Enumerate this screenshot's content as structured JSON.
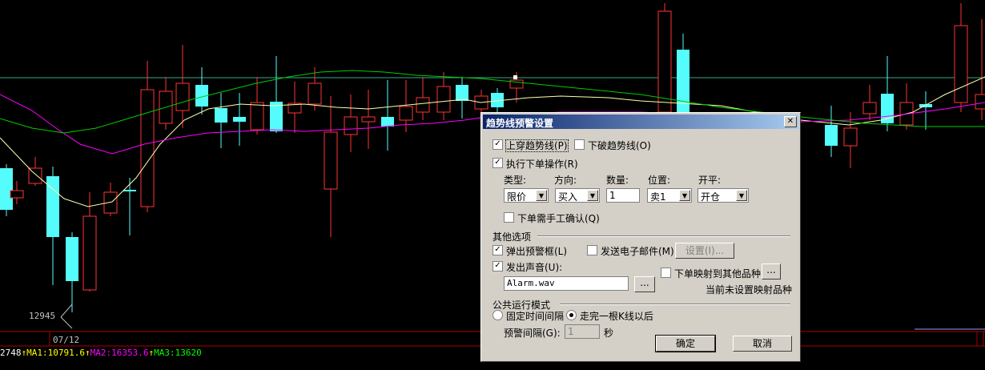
{
  "chart": {
    "low_price_label": "12945",
    "date_label": "07/12",
    "ma_bar": {
      "prefix": "2748",
      "ma1": "MA1:10791.6",
      "ma2": "MA2:16353.6",
      "ma3": "MA3:13620",
      "arrow": "↑",
      "colors": {
        "prefix": "#ffffff",
        "ma1": "#ffff00",
        "ma2": "#ff00ff",
        "ma3": "#00ff00",
        "arrow": "#ffff00"
      }
    },
    "colors": {
      "up": "#ff3333",
      "down": "#54fcfc",
      "ma1": "#ffffaa",
      "ma2": "#ff00ff",
      "ma3": "#00cc00",
      "ref": "#33aa88"
    }
  },
  "dialog": {
    "title": "趋势线预警设置",
    "close_glyph": "✕",
    "cross_up_label": "上穿趋势线(P)",
    "cross_up_checked": true,
    "break_down_label": "下破趋势线(O)",
    "break_down_checked": false,
    "exec_order_label": "执行下单操作(R)",
    "exec_order_checked": true,
    "order": {
      "type_label": "类型:",
      "type_value": "限价",
      "direction_label": "方向:",
      "direction_value": "买入",
      "qty_label": "数量:",
      "qty_value": "1",
      "position_label": "位置:",
      "position_value": "卖1",
      "open_close_label": "开平:",
      "open_close_value": "开仓"
    },
    "manual_confirm_label": "下单需手工确认(Q)",
    "manual_confirm_checked": false,
    "other_options_title": "其他选项",
    "popup_label": "弹出预警框(L)",
    "popup_checked": true,
    "email_label": "发送电子邮件(M)",
    "email_checked": false,
    "settings_button": "设置(I)...",
    "sound_label": "发出声音(U):",
    "sound_checked": true,
    "sound_file": "Alarm.wav",
    "browse_button": "...",
    "map_label": "下单映射到其他品种",
    "map_checked": false,
    "map_button": "...",
    "map_status": "当前未设置映射品种",
    "run_mode_title": "公共运行模式",
    "fixed_interval_label": "固定时间间隔",
    "after_kline_label": "走完一根K线以后",
    "selected_mode": "after_kline",
    "interval_label": "预警间隔(G):",
    "interval_value": "1",
    "interval_unit": "秒",
    "ok_button": "确定",
    "cancel_button": "取消"
  }
}
